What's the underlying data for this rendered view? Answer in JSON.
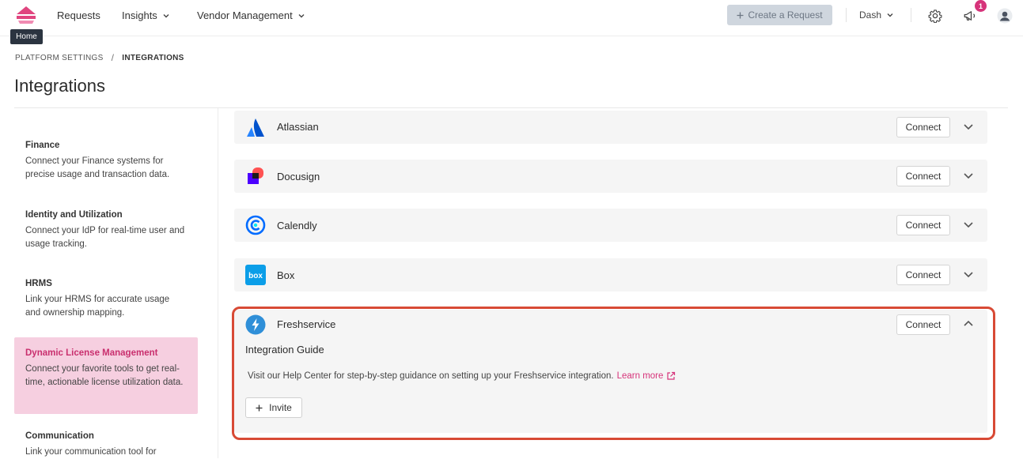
{
  "nav": {
    "items": [
      {
        "label": "Requests",
        "has_dropdown": false
      },
      {
        "label": "Insights",
        "has_dropdown": true
      },
      {
        "label": "Vendor Management",
        "has_dropdown": true
      }
    ],
    "create_request_label": "Create a Request",
    "workspace_label": "Dash",
    "notification_count": "1",
    "tooltip": "Home"
  },
  "breadcrumb": {
    "parent": "PLATFORM SETTINGS",
    "separator": "/",
    "current": "INTEGRATIONS"
  },
  "page_title": "Integrations",
  "sidebar": {
    "items": [
      {
        "title": "Finance",
        "desc": "Connect your Finance systems for precise usage and transaction data.",
        "active": false
      },
      {
        "title": "Identity and Utilization",
        "desc": "Connect your IdP for real-time user and usage tracking.",
        "active": false
      },
      {
        "title": "HRMS",
        "desc": "Link your HRMS for accurate usage and ownership mapping.",
        "active": false
      },
      {
        "title": "Dynamic License Management",
        "desc": "Connect your favorite tools to get real-time, actionable license utilization data.",
        "active": true
      },
      {
        "title": "Communication",
        "desc": "Link your communication tool for",
        "active": false
      }
    ]
  },
  "integrations": [
    {
      "name": "Atlassian",
      "icon": "atlassian-logo",
      "connect_label": "Connect",
      "expanded": false
    },
    {
      "name": "Docusign",
      "icon": "docusign-logo",
      "connect_label": "Connect",
      "expanded": false
    },
    {
      "name": "Calendly",
      "icon": "calendly-logo",
      "connect_label": "Connect",
      "expanded": false
    },
    {
      "name": "Box",
      "icon": "box-logo",
      "connect_label": "Connect",
      "expanded": false
    },
    {
      "name": "Freshservice",
      "icon": "freshservice-logo",
      "connect_label": "Connect",
      "expanded": true
    }
  ],
  "guide": {
    "title": "Integration Guide",
    "text": "Visit our Help Center for step-by-step guidance on setting up your Freshservice integration.",
    "link_label": "Learn more",
    "invite_label": "Invite"
  },
  "box_logo_text": "box",
  "colors": {
    "accent": "#d6337a",
    "active_bg": "#f6cfe0",
    "highlight_border": "#d84a35",
    "card_bg": "#f5f5f5"
  }
}
